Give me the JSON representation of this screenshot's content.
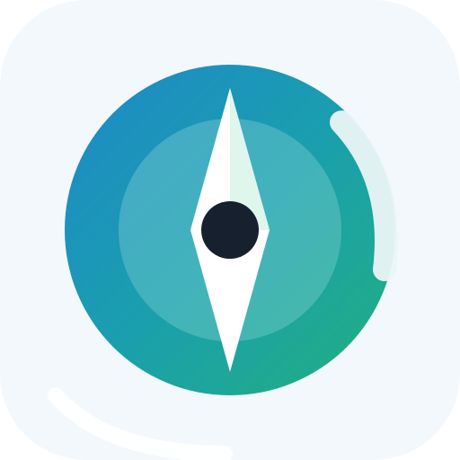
{
  "icon": {
    "name": "compass-app-icon",
    "glyph": "compass-icon"
  },
  "colors": {
    "background": "#ffffff",
    "tile": "#f3f8fc",
    "tile_highlight": "#ffffff",
    "dial_start": "#1e88c8",
    "dial_mid": "#1a9fae",
    "dial_end": "#22b07f",
    "inner_ring": "#8fd6d8",
    "needle": "#ffffff",
    "needle_shade": "#dff6ec",
    "pivot": "#17202f",
    "gloss": "#eaf6f6"
  }
}
